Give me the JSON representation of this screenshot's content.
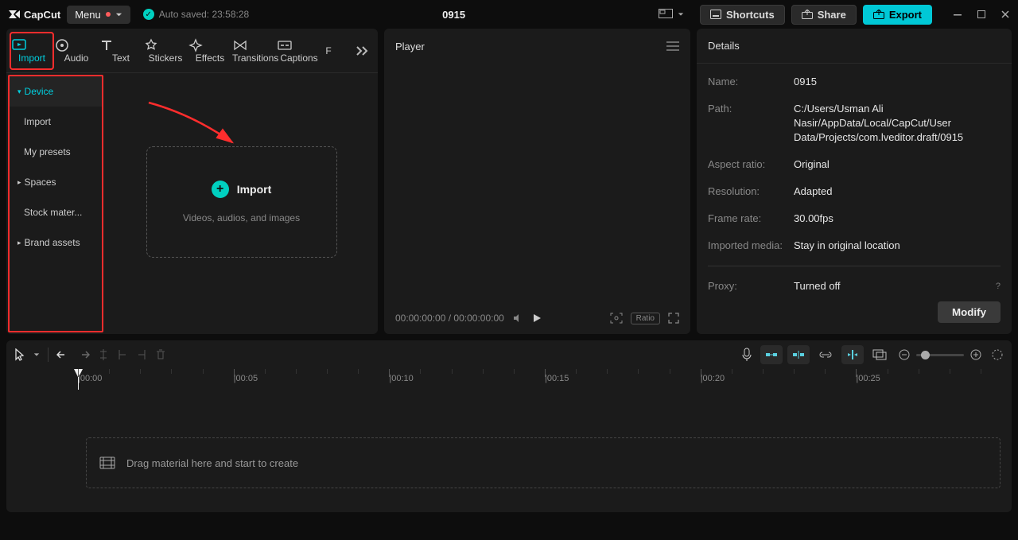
{
  "titlebar": {
    "app_name": "CapCut",
    "menu_label": "Menu",
    "auto_saved_label": "Auto saved: 23:58:28",
    "project_title": "0915",
    "shortcuts_label": "Shortcuts",
    "share_label": "Share",
    "export_label": "Export"
  },
  "source_tabs": [
    {
      "label": "Import",
      "active": true
    },
    {
      "label": "Audio",
      "active": false
    },
    {
      "label": "Text",
      "active": false
    },
    {
      "label": "Stickers",
      "active": false
    },
    {
      "label": "Effects",
      "active": false
    },
    {
      "label": "Transitions",
      "active": false
    },
    {
      "label": "Captions",
      "active": false
    },
    {
      "label": "F",
      "active": false
    }
  ],
  "import_sidebar": [
    {
      "label": "Device",
      "active": true,
      "expandable": true
    },
    {
      "label": "Import",
      "active": false,
      "expandable": false
    },
    {
      "label": "My presets",
      "active": false,
      "expandable": false
    },
    {
      "label": "Spaces",
      "active": false,
      "expandable": true
    },
    {
      "label": "Stock mater...",
      "active": false,
      "expandable": false
    },
    {
      "label": "Brand assets",
      "active": false,
      "expandable": true
    }
  ],
  "import_box": {
    "title": "Import",
    "subtitle": "Videos, audios, and images"
  },
  "player": {
    "header": "Player",
    "time_current": "00:00:00:00",
    "time_total": "00:00:00:00",
    "ratio_badge": "Ratio"
  },
  "details": {
    "header": "Details",
    "rows": {
      "name": {
        "label": "Name:",
        "value": "0915"
      },
      "path": {
        "label": "Path:",
        "value": "C:/Users/Usman Ali Nasir/AppData/Local/CapCut/User Data/Projects/com.lveditor.draft/0915"
      },
      "aspect": {
        "label": "Aspect ratio:",
        "value": "Original"
      },
      "resolution": {
        "label": "Resolution:",
        "value": "Adapted"
      },
      "framerate": {
        "label": "Frame rate:",
        "value": "30.00fps"
      },
      "imported": {
        "label": "Imported media:",
        "value": "Stay in original location"
      },
      "proxy": {
        "label": "Proxy:",
        "value": "Turned off"
      }
    },
    "modify_label": "Modify"
  },
  "timeline": {
    "ticks": [
      "00:00",
      "00:05",
      "00:10",
      "00:15",
      "00:20",
      "00:25"
    ],
    "drop_hint": "Drag material here and start to create"
  }
}
